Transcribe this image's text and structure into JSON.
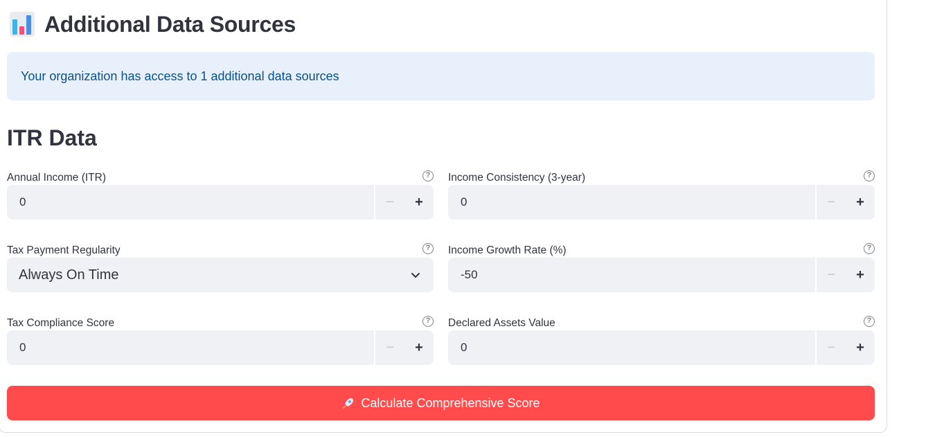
{
  "header": {
    "icon": "bar-chart-icon",
    "title": "Additional Data Sources"
  },
  "info_message": "Your organization has access to 1 additional data sources",
  "section": {
    "title": "ITR Data"
  },
  "fields": {
    "annual_income": {
      "label": "Annual Income (ITR)",
      "value": "0"
    },
    "income_consistency": {
      "label": "Income Consistency (3-year)",
      "value": "0"
    },
    "tax_payment_regularity": {
      "label": "Tax Payment Regularity",
      "value": "Always On Time"
    },
    "income_growth_rate": {
      "label": "Income Growth Rate (%)",
      "value": "-50"
    },
    "tax_compliance_score": {
      "label": "Tax Compliance Score",
      "value": "0"
    },
    "declared_assets_value": {
      "label": "Declared Assets Value",
      "value": "0"
    }
  },
  "stepper": {
    "minus": "−",
    "plus": "+"
  },
  "help_glyph": "?",
  "action": {
    "icon": "rocket-icon",
    "label": "Calculate Comprehensive Score"
  },
  "colors": {
    "primary": "#ff4b4b",
    "info_bg": "#e8f1fb",
    "info_text": "#0b4f8a",
    "input_bg": "#eff1f5"
  }
}
